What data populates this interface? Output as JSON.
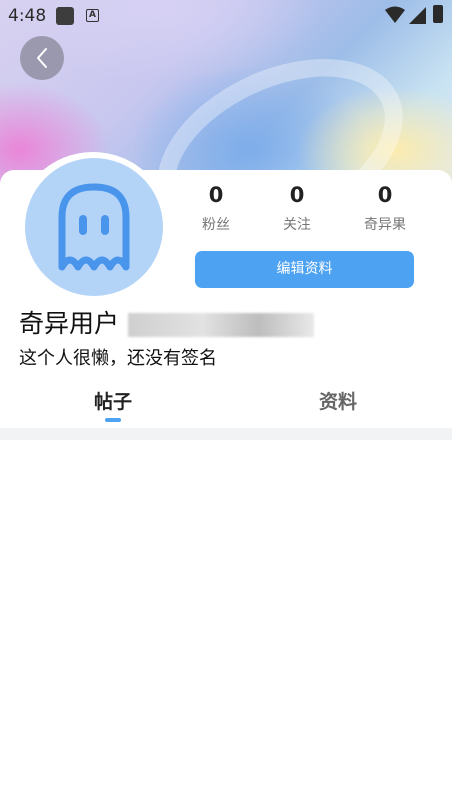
{
  "status_bar": {
    "time": "4:48"
  },
  "profile": {
    "username": "奇异用户",
    "signature": "这个人很懒，还没有签名",
    "edit_button": "编辑资料"
  },
  "stats": [
    {
      "value": "0",
      "label": "粉丝"
    },
    {
      "value": "0",
      "label": "关注"
    },
    {
      "value": "0",
      "label": "奇异果"
    }
  ],
  "tabs": [
    {
      "label": "帖子",
      "selected": true
    },
    {
      "label": "资料",
      "selected": false
    }
  ],
  "colors": {
    "accent": "#4da2f2",
    "avatar_bg": "#b3d4f7",
    "avatar_icon": "#4a95ec"
  },
  "icons": {
    "back": "chevron-left-icon",
    "avatar": "ghost-icon"
  }
}
